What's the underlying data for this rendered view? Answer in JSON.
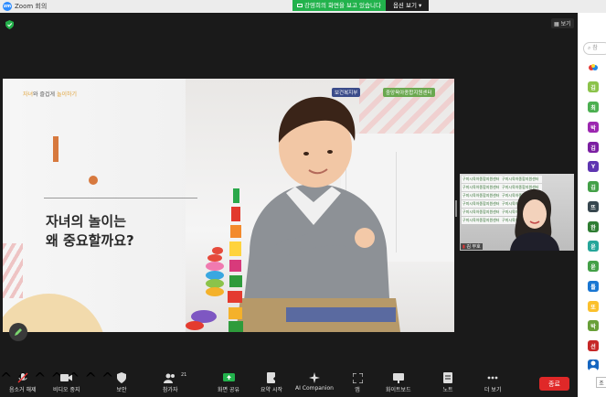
{
  "window": {
    "app_title": "Zoom 회의"
  },
  "share_banner": {
    "status": "강영희의 화면을 보고 있습니다",
    "options": "옵션 보기"
  },
  "meeting": {
    "view_label": "보기"
  },
  "slide": {
    "tag_prefix": "자녀",
    "tag_middle": "와 즐겁게 ",
    "tag_suffix": "놀이하기",
    "logo1": "보건복지부",
    "logo2": "중앙육아종합지원센터",
    "heading_line1": "자녀의 놀이는",
    "heading_line2": "왜 중요할까요?"
  },
  "video": {
    "posters": [
      [
        "구미시육아종합지원센터",
        "구미시육아종합지원센터"
      ],
      [
        "구미시육아종합지원센터",
        "구미시육아종합지원센터"
      ],
      [
        "구미시육아종합지원센터",
        "구미시육아종합지원센터"
      ],
      [
        "구미시육아종합지원센터",
        "구미시육아종합지원센터"
      ],
      [
        "구미시육아종합지원센터",
        "구미시육아종합지원센터"
      ],
      [
        "구미시육아종합지원센터",
        "구미시육아종합지원센터"
      ]
    ],
    "name": "김 무호"
  },
  "panel": {
    "search_placeholder": "참",
    "avatars": [
      {
        "label": "",
        "color": "#ffffff"
      },
      {
        "label": "김",
        "color": "#8bc34a"
      },
      {
        "label": "최",
        "color": "#4caf50"
      },
      {
        "label": "박",
        "color": "#9c27b0"
      },
      {
        "label": "김",
        "color": "#7b1fa2"
      },
      {
        "label": "Y",
        "color": "#5e35b1"
      },
      {
        "label": "김",
        "color": "#43a047"
      },
      {
        "label": "뜨",
        "color": "#37474f"
      },
      {
        "label": "한",
        "color": "#2e7d32"
      },
      {
        "label": "윤",
        "color": "#26a69a"
      },
      {
        "label": "윤",
        "color": "#43a047"
      },
      {
        "label": "틀",
        "color": "#1976d2"
      },
      {
        "label": "또",
        "color": "#fbc02d"
      },
      {
        "label": "박",
        "color": "#689f38"
      },
      {
        "label": "선",
        "color": "#c62828"
      },
      {
        "label": "",
        "color": "#1565c0"
      }
    ],
    "bottom_button": "조"
  },
  "toolbar": {
    "buttons": [
      {
        "label": "음소거 해제",
        "icon": "mic-muted-icon"
      },
      {
        "label": "비디오 중지",
        "icon": "video-icon"
      },
      {
        "label": "보안",
        "icon": "shield-icon"
      },
      {
        "label": "참가자",
        "icon": "participants-icon",
        "count": "21"
      },
      {
        "label": "화면 공유",
        "icon": "share-screen-icon"
      },
      {
        "label": "요약 시작",
        "icon": "summary-icon"
      },
      {
        "label": "AI Companion",
        "icon": "ai-companion-icon"
      },
      {
        "label": "앱",
        "icon": "apps-icon"
      },
      {
        "label": "화이트보드",
        "icon": "whiteboard-icon"
      },
      {
        "label": "노트",
        "icon": "notes-icon"
      },
      {
        "label": "더 보기",
        "icon": "more-icon"
      }
    ],
    "end_label": "종료"
  },
  "colors": {
    "share_green": "#22b24c",
    "end_red": "#e02828",
    "slide_accent": "#d7793e",
    "background": "#1a1a1a"
  }
}
